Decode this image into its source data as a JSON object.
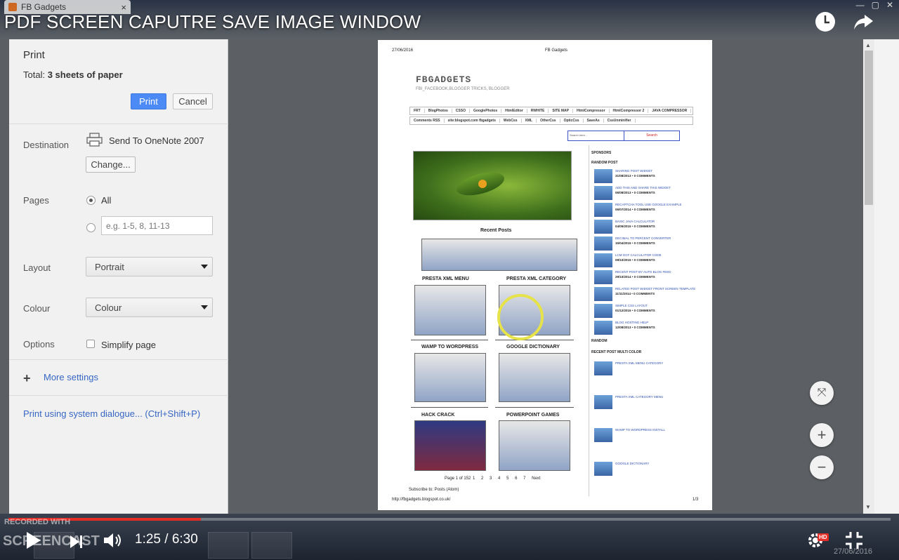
{
  "video": {
    "title": "PDF SCREEN CAPUTRE SAVE IMAGE WINDOW",
    "time": "1:25 / 6:30",
    "progress": 0.218,
    "hd_badge": "HD",
    "watermark_line1": "RECORDED WITH",
    "watermark_line2": "SCREENCAST",
    "clock_icon": "clock-icon",
    "share_icon": "share-arrow-icon",
    "accent_color": "#e52d27"
  },
  "browser": {
    "tab_title": "FB Gadgets",
    "tab_close": "×",
    "url": "fbgadgets.blogspot.co.uk"
  },
  "print": {
    "title": "Print",
    "total_prefix": "Total:",
    "total_value": "3 sheets of paper",
    "print_button": "Print",
    "cancel_button": "Cancel",
    "destination_label": "Destination",
    "destination_name": "Send To OneNote 2007",
    "change_button": "Change...",
    "pages_label": "Pages",
    "pages_all": "All",
    "pages_placeholder": "e.g. 1-5, 8, 11-13",
    "layout_label": "Layout",
    "layout_value": "Portrait",
    "colour_label": "Colour",
    "colour_value": "Colour",
    "options_label": "Options",
    "simplify_page": "Simplify page",
    "more_settings": "More settings",
    "system_dialogue": "Print using system dialogue... (Ctrl+Shift+P)",
    "button_color": "#4c8bf5"
  },
  "preview": {
    "header_date": "27/06/2016",
    "header_title": "FB Gadgets",
    "site_title": "FBGADGETS",
    "site_desc": "FBI_FACEBOOK,BLOGGER TRICKS, BLOGGER",
    "menu_row1": [
      "FRT",
      "BlogPhotos",
      "CSSO",
      "GooglePhotos",
      "HtmlEditor",
      "RWHITE",
      "SITE MAP",
      "HtmlCompressor",
      "HtmlCompressor 2",
      "JAVA COMPRESSOR"
    ],
    "menu_row2": [
      "Comments RSS",
      "site:blogspot.com fbgadgets",
      "WebCss",
      "XML",
      "OtherCss",
      "OpticCss",
      "SaveAs",
      "CssUnminifier"
    ],
    "search_placeholder": "Search here...",
    "search_button": "Search",
    "recent_posts": "Recent Posts",
    "posts": [
      "PRESTA XML MENU",
      "PRESTA XML CATEGORY",
      "WAMP TO WORDPRESS",
      "GOOGLE DICTIONARY",
      "HACK CRACK",
      "POWERPOINT GAMES"
    ],
    "pagination": "Page 1 of 152",
    "pages_nums": [
      "1",
      "2",
      "3",
      "4",
      "5",
      "6",
      "7",
      "Next"
    ],
    "subscribe": "Subscribe to: Posts (Atom)",
    "footer_url": "http://fbgadgets.blogspot.co.uk/",
    "footer_page": "1/3",
    "sponsors": "SPONSORS",
    "random_post": "RANDOM POST",
    "random": "RANDOM",
    "recent_multi": "RECENT POST MULTI COLOR",
    "sidebar_posts": [
      {
        "title": "SHARING POST WIDGET",
        "meta": "31/08/2013 • 0 COMMENTS"
      },
      {
        "title": "ADD THIS AND SHARE THIS WIDGET",
        "meta": "06/08/2013 • 0 COMMENTS"
      },
      {
        "title": "RECAPTCHA TOOL USE GOOGLE EXAMPLE",
        "meta": "06/07/2014 • 0 COMMENTS"
      },
      {
        "title": "BASIC JAVA CALCULATOR",
        "meta": "04/05/2015 • 0 COMMENTS"
      },
      {
        "title": "DECIMAL TO PERCENT CONVERTER",
        "meta": "15/04/2015 • 0 COMMENTS"
      },
      {
        "title": "LCM GCF CALCULATOR CODE",
        "meta": "09/10/2015 • 0 COMMENTS"
      },
      {
        "title": "RECENT POST BY AUTO BLOG FEED",
        "meta": "29/10/2014 • 0 COMMENTS"
      },
      {
        "title": "RELATED POST WIDGET FRONT SCREEN TEMPLATE",
        "meta": "11/11/2014 • 0 COMMENTS"
      },
      {
        "title": "SIMPLE CSS LAYOUT",
        "meta": "01/12/2015 • 0 COMMENTS"
      },
      {
        "title": "BLOG HOSTING HELP",
        "meta": "12/08/2013 • 0 COMMENTS"
      }
    ],
    "multi_posts": [
      "PRESTA XML MENU CATEGORY",
      "PRESTA XML CATEGORY MENU",
      "WAMP TO WORDPRESS INSTALL",
      "GOOGLE DICTIONARY"
    ]
  },
  "zoom": {
    "fit": "⤧",
    "zoom_in": "+",
    "zoom_out": "−"
  },
  "taskbar": {
    "date": "27/06/2016"
  }
}
